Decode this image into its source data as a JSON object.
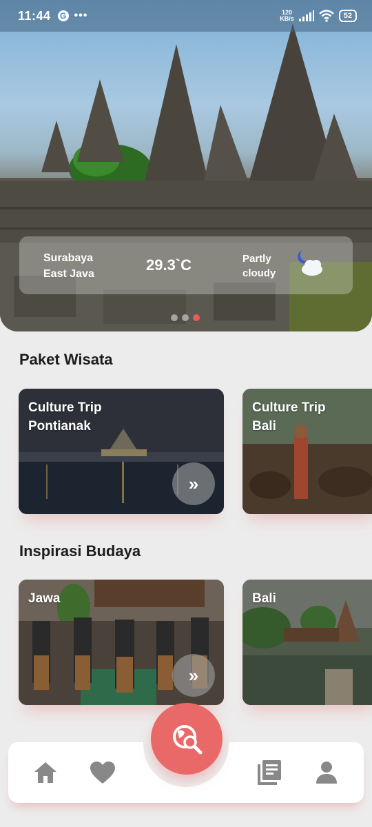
{
  "status_bar": {
    "time": "11:44",
    "google_icon": "G",
    "more_dots": "•••",
    "net_speed_value": "120",
    "net_speed_unit": "KB/s",
    "battery": "52"
  },
  "weather": {
    "city": "Surabaya",
    "province": "East Java",
    "temperature": "29.3`C",
    "condition_line1": "Partly",
    "condition_line2": "cloudy",
    "icon": "partly-cloudy-night-icon"
  },
  "hero": {
    "slides": 3,
    "active_slide": 3
  },
  "sections": {
    "packages": {
      "title": "Paket Wisata",
      "cards": [
        {
          "line1": "Culture Trip",
          "line2": "Pontianak",
          "more": "»"
        },
        {
          "line1": "Culture Trip",
          "line2": "Bali"
        }
      ]
    },
    "culture": {
      "title": "Inspirasi Budaya",
      "cards": [
        {
          "label": "Jawa",
          "more": "»"
        },
        {
          "label": "Bali"
        }
      ]
    }
  },
  "bottom_nav": {
    "items": [
      "home-icon",
      "heart-icon",
      "explore-search-icon",
      "news-icon",
      "profile-icon"
    ]
  },
  "colors": {
    "accent": "#e96868",
    "background": "#ececec"
  }
}
